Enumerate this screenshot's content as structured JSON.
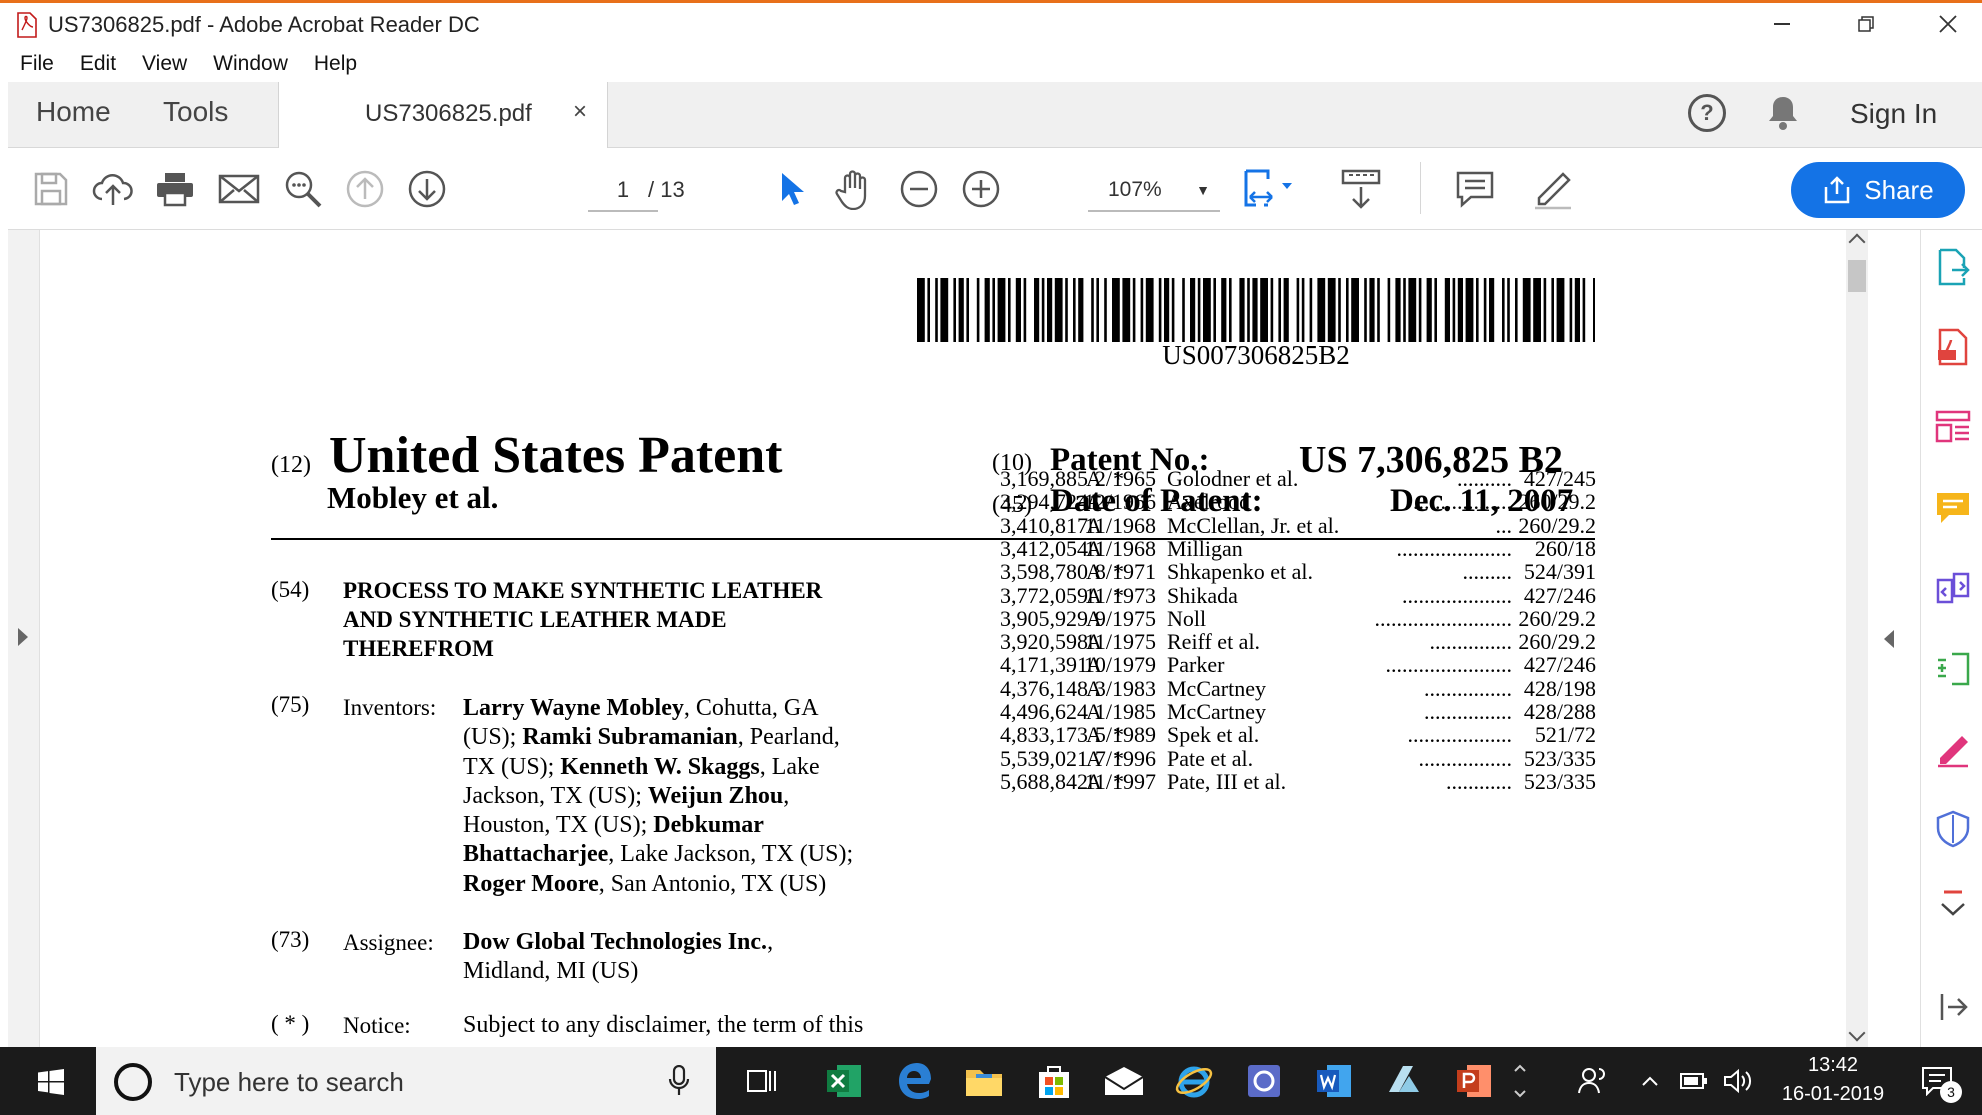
{
  "window": {
    "title": "US7306825.pdf - Adobe Acrobat Reader DC",
    "controls": [
      "minimize",
      "restore",
      "close"
    ]
  },
  "menu": [
    "File",
    "Edit",
    "View",
    "Window",
    "Help"
  ],
  "tabs": {
    "home": "Home",
    "tools": "Tools",
    "document": "US7306825.pdf",
    "close_glyph": "×",
    "sign_in": "Sign In"
  },
  "toolbar": {
    "current_page": "1",
    "page_total": "/ 13",
    "zoom": "107%",
    "share_label": "Share",
    "icons": [
      "save-icon",
      "upload-icon",
      "print-icon",
      "email-icon",
      "find-icon",
      "prev-page-icon",
      "next-page-icon",
      "select-cursor-icon",
      "hand-icon",
      "zoom-out-icon",
      "zoom-in-icon",
      "fit-page-icon",
      "scroll-mode-icon",
      "comment-icon",
      "sign-pen-icon"
    ]
  },
  "document": {
    "barcode_number": "US007306825B2",
    "code12": "(12)",
    "heading": "United States Patent",
    "authors": "Mobley et al.",
    "code10": "(10)",
    "patent_no_label": "Patent No.:",
    "patent_no": "US 7,306,825 B2",
    "code45": "(45)",
    "date_label": "Date of Patent:",
    "date": "Dec. 11, 2007",
    "code54": "(54)",
    "title_lines": [
      "PROCESS TO MAKE SYNTHETIC LEATHER",
      "AND SYNTHETIC LEATHER MADE",
      "THEREFROM"
    ],
    "code75": "(75)",
    "inventors_label": "Inventors:",
    "inventor_lines": [
      [
        {
          "b": "Larry Wayne Mobley"
        },
        {
          "t": ", Cohutta, GA"
        }
      ],
      [
        {
          "t": "(US); "
        },
        {
          "b": "Ramki Subramanian"
        },
        {
          "t": ", Pearland,"
        }
      ],
      [
        {
          "t": "TX (US); "
        },
        {
          "b": "Kenneth W. Skaggs"
        },
        {
          "t": ", Lake"
        }
      ],
      [
        {
          "t": "Jackson, TX (US); "
        },
        {
          "b": "Weijun Zhou"
        },
        {
          "t": ","
        }
      ],
      [
        {
          "t": "Houston, TX (US); "
        },
        {
          "b": "Debkumar"
        }
      ],
      [
        {
          "b": "Bhattacharjee"
        },
        {
          "t": ", Lake Jackson, TX (US);"
        }
      ],
      [
        {
          "b": "Roger Moore"
        },
        {
          "t": ", San Antonio, TX (US)"
        }
      ]
    ],
    "code73": "(73)",
    "assignee_label": "Assignee:",
    "assignee_name": "Dow Global Technologies Inc.",
    "assignee_comma": ",",
    "assignee_city": "Midland, MI (US)",
    "code_notice": "( * )",
    "notice_label": "Notice:",
    "notice_text": "Subject to any disclaimer, the term of this",
    "references": [
      {
        "num": "3,169,885",
        "kind": "A",
        "star": "*",
        "date": "2/1965",
        "name": "Golodner et al.",
        "dots": "..........",
        "cls": "427/245"
      },
      {
        "num": "3,294,724",
        "kind": "A",
        "star": "",
        "date": "12/1966",
        "name": "Axelrood",
        "dots": "..................",
        "cls": "260/29.2"
      },
      {
        "num": "3,410,817",
        "kind": "A",
        "star": "",
        "date": "11/1968",
        "name": "McClellan, Jr. et al.",
        "dots": "...",
        "cls": "260/29.2"
      },
      {
        "num": "3,412,054",
        "kind": "A",
        "star": "",
        "date": "11/1968",
        "name": "Milligan",
        "dots": ".....................",
        "cls": "260/18"
      },
      {
        "num": "3,598,780",
        "kind": "A",
        "star": "*",
        "date": "8/1971",
        "name": "Shkapenko et al.",
        "dots": ".........",
        "cls": "524/391"
      },
      {
        "num": "3,772,059",
        "kind": "A",
        "star": "*",
        "date": "11/1973",
        "name": "Shikada",
        "dots": "....................",
        "cls": "427/246"
      },
      {
        "num": "3,905,929",
        "kind": "A",
        "star": "",
        "date": "9/1975",
        "name": "Noll",
        "dots": ".........................",
        "cls": "260/29.2"
      },
      {
        "num": "3,920,598",
        "kind": "A",
        "star": "",
        "date": "11/1975",
        "name": "Reiff et al.",
        "dots": "...............",
        "cls": "260/29.2"
      },
      {
        "num": "4,171,391",
        "kind": "A",
        "star": "",
        "date": "10/1979",
        "name": "Parker",
        "dots": ".......................",
        "cls": "427/246"
      },
      {
        "num": "4,376,148",
        "kind": "A",
        "star": "",
        "date": "3/1983",
        "name": "McCartney",
        "dots": "................",
        "cls": "428/198"
      },
      {
        "num": "4,496,624",
        "kind": "A",
        "star": "",
        "date": "1/1985",
        "name": "McCartney",
        "dots": "................",
        "cls": "428/288"
      },
      {
        "num": "4,833,173",
        "kind": "A",
        "star": "*",
        "date": "5/1989",
        "name": "Spek et al.",
        "dots": "...................",
        "cls": "521/72"
      },
      {
        "num": "5,539,021",
        "kind": "A",
        "star": "*",
        "date": "7/1996",
        "name": "Pate et al.",
        "dots": ".................",
        "cls": "523/335"
      },
      {
        "num": "5,688,842",
        "kind": "A",
        "star": "*",
        "date": "11/1997",
        "name": "Pate, III et al.",
        "dots": "............",
        "cls": "523/335"
      }
    ]
  },
  "taskbar": {
    "search_placeholder": "Type here to search",
    "time": "13:42",
    "date": "16-01-2019",
    "notification_count": "3",
    "apps": [
      "task-view-icon",
      "excel-icon",
      "edge-icon",
      "file-explorer-icon",
      "store-icon",
      "mail-icon",
      "internet-explorer-icon",
      "remote-desktop-icon",
      "word-icon",
      "azure-icon",
      "powerpoint-icon"
    ]
  },
  "colors": {
    "accent": "#1473e6",
    "title_border": "#e8701a",
    "taskbar": "#1b1b1b",
    "tool_pink": "#e0357c"
  }
}
